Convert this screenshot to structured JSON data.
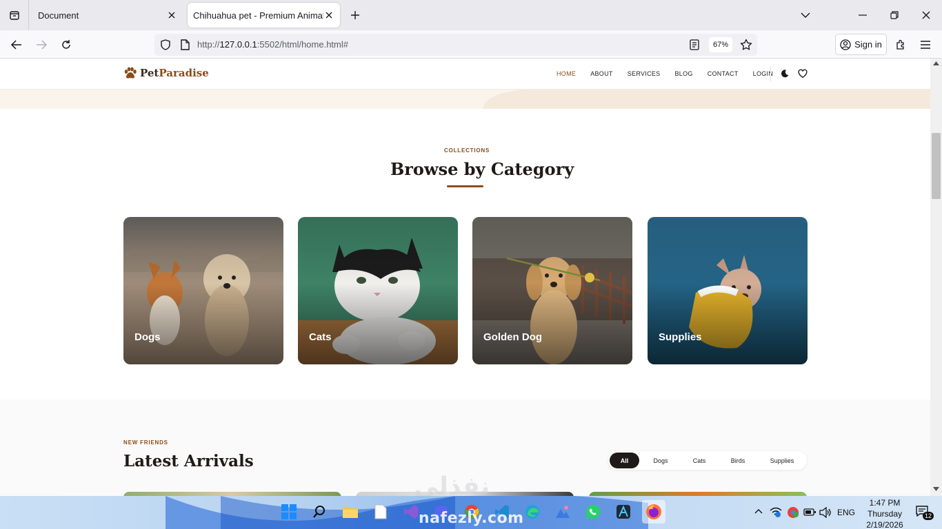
{
  "browser": {
    "tabs": [
      {
        "title": "Document"
      },
      {
        "title": "Chihuahua pet - Premium Animal St"
      }
    ],
    "url": {
      "scheme_host_prefix": "http://",
      "host": "127.0.0.1",
      "rest": ":5502/html/home.html#"
    },
    "zoom": "67%",
    "sign_in": "Sign in"
  },
  "site": {
    "logo": {
      "part1": "Pet",
      "part2": "Paradise"
    },
    "menu": [
      "HOME",
      "ABOUT",
      "SERVICES",
      "BLOG",
      "CONTACT",
      "LOGIN"
    ],
    "active_menu": "HOME"
  },
  "collections": {
    "eyebrow": "COLLECTIONS",
    "title": "Browse by Category",
    "accent_color": "#8a4d1a",
    "cards": [
      {
        "label": "Dogs"
      },
      {
        "label": "Cats"
      },
      {
        "label": "Golden Dog"
      },
      {
        "label": "Supplies"
      }
    ]
  },
  "arrivals": {
    "eyebrow": "NEW FRIENDS",
    "title": "Latest Arrivals",
    "filters": [
      "All",
      "Dogs",
      "Cats",
      "Birds",
      "Supplies"
    ],
    "active_filter": "All"
  },
  "taskbar": {
    "language": "ENG",
    "time": "1:47 PM",
    "day": "Thursday",
    "date": "2/19/2026",
    "notifications": "12",
    "watermark": "nafezly.com",
    "watermark_ar": "نفذلي"
  }
}
